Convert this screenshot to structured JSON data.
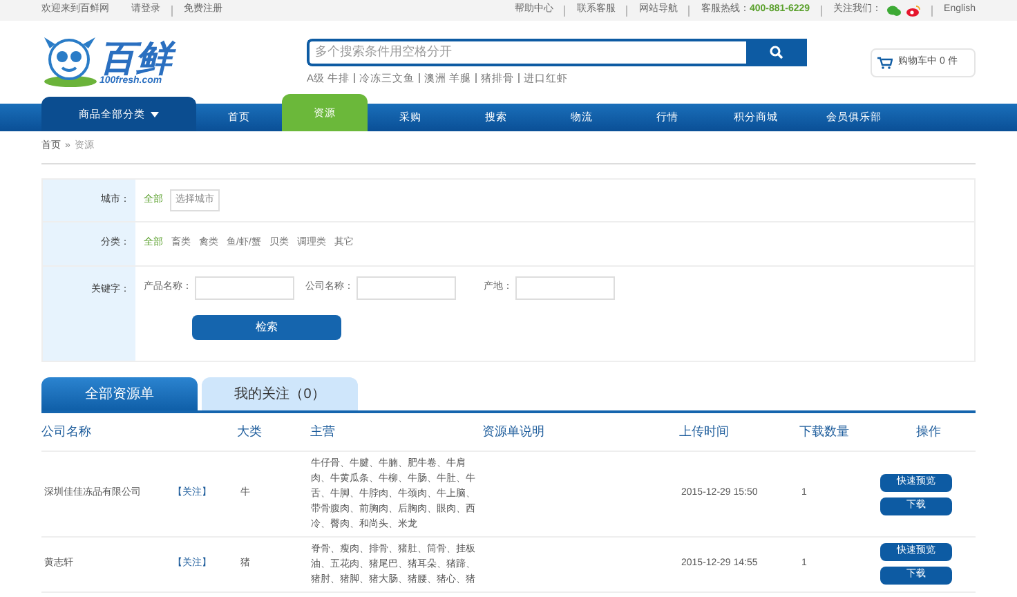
{
  "top_bar": {
    "left_links": [
      "欢迎来到百鲜网",
      "请登录",
      "免费注册"
    ],
    "right_links": [
      "帮助中心",
      "联系客服",
      "网站导航"
    ],
    "hotline_label": "客服热线：",
    "hotline": "400-881-6229",
    "follow_label": "关注我们：",
    "language": "English"
  },
  "logo": {
    "name": "百鲜",
    "domain": "100fresh.com"
  },
  "search": {
    "placeholder": "多个搜索条件用空格分开",
    "hot_words": [
      "A级 牛排",
      "冷冻三文鱼",
      "澳洲 羊腿",
      "猪排骨",
      "进口红虾"
    ]
  },
  "cart": {
    "label": "购物车中 0 件"
  },
  "nav": {
    "category_menu": "商品全部分类",
    "items": [
      {
        "label": "首页",
        "selected": false
      },
      {
        "label": "资源",
        "selected": true
      },
      {
        "label": "采购",
        "selected": false
      },
      {
        "label": "搜索",
        "selected": false
      },
      {
        "label": "物流",
        "selected": false
      },
      {
        "label": "行情",
        "selected": false
      },
      {
        "label": "积分商城",
        "selected": false
      },
      {
        "label": "会员俱乐部",
        "selected": false
      }
    ]
  },
  "breadcrumb": [
    "首页",
    "»",
    "资源"
  ],
  "filters": {
    "city": {
      "label": "城市：",
      "options": [
        {
          "label": "全部",
          "selected": true
        }
      ],
      "select_button": "选择城市"
    },
    "category": {
      "label": "分类：",
      "options": [
        {
          "label": "全部",
          "selected": true
        },
        {
          "label": "畜类",
          "selected": false
        },
        {
          "label": "禽类",
          "selected": false
        },
        {
          "label": "鱼/虾/蟹",
          "selected": false
        },
        {
          "label": "贝类",
          "selected": false
        },
        {
          "label": "调理类",
          "selected": false
        },
        {
          "label": "其它",
          "selected": false
        }
      ]
    },
    "keyword": {
      "label": "关键字：",
      "fields": [
        "产品名称：",
        "公司名称：",
        "产地："
      ]
    },
    "search_button": "检索"
  },
  "tabs": [
    {
      "label": "全部资源单",
      "selected": true
    },
    {
      "label": "我的关注（0）",
      "selected": false
    }
  ],
  "table": {
    "columns": [
      "公司名称",
      "大类",
      "主营",
      "资源单说明",
      "上传时间",
      "下载数量",
      "操作"
    ],
    "rows": [
      {
        "company": "深圳佳佳冻品有限公司",
        "follow": "【关注】",
        "category": "牛",
        "main": "牛仔骨、牛腱、牛腩、肥牛卷、牛肩肉、牛黄瓜条、牛柳、牛肠、牛肚、牛舌、牛脚、牛脖肉、牛颈肉、牛上脑、带骨腹肉、前胸肉、后胸肉、眼肉、西冷、臀肉、和尚头、米龙",
        "time": "2015-12-29 15:50",
        "downloads": "1",
        "actions": [
          "快速预览",
          "下载"
        ]
      },
      {
        "company": "黄志轩",
        "follow": "【关注】",
        "category": "猪",
        "main": "脊骨、瘦肉、排骨、猪肚、筒骨、挂板油、五花肉、猪尾巴、猪耳朵、猪蹄、猪肘、猪脚、猪大肠、猪腰、猪心、猪",
        "time": "2015-12-29 14:55",
        "downloads": "1",
        "actions": [
          "快速预览",
          "下载"
        ]
      }
    ]
  }
}
